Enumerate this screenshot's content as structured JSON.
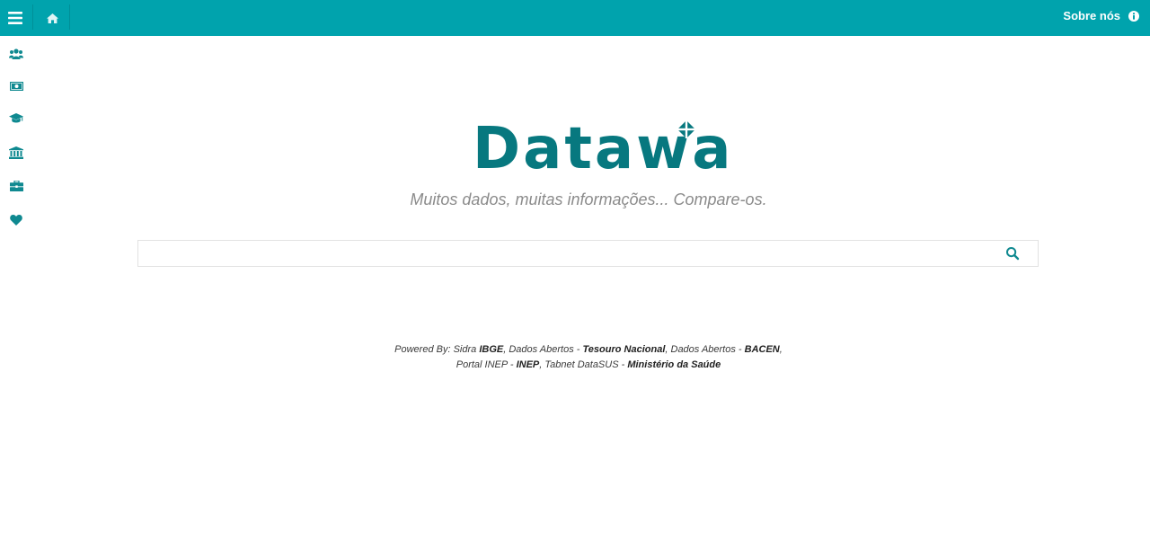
{
  "colors": {
    "brand": "#00a3ad",
    "logo": "#07787f",
    "icon": "#0f8990",
    "tagline": "#8b8b8b"
  },
  "topbar": {
    "menu_icon": "hamburger-menu-icon",
    "home_icon": "home-icon",
    "about_label": "Sobre nós",
    "about_icon": "info-circle-icon"
  },
  "sidebar": {
    "items": [
      {
        "icon": "users-icon"
      },
      {
        "icon": "money-bill-icon"
      },
      {
        "icon": "graduation-cap-icon"
      },
      {
        "icon": "institution-icon"
      },
      {
        "icon": "briefcase-icon"
      },
      {
        "icon": "heart-icon"
      }
    ]
  },
  "logo": {
    "text": "Datawa"
  },
  "tagline": "Muitos dados, muitas informações... Compare-os.",
  "search": {
    "value": "",
    "placeholder": "",
    "icon": "search-icon"
  },
  "credits": {
    "intro": "Powered By: Sidra ",
    "sources": [
      {
        "name": "IBGE",
        "sep": ", "
      },
      {
        "name": "Dados Abertos - ",
        "bold": "Tesouro Nacional",
        "sep": ", "
      },
      {
        "name": "Dados Abertos - ",
        "bold": "BACEN",
        "sep": ","
      }
    ],
    "line2": [
      {
        "name": "Portal INEP - ",
        "bold": "INEP",
        "sep": ", "
      },
      {
        "name": "Tabnet DataSUS - ",
        "bold": "Ministério da Saúde",
        "sep": ""
      }
    ]
  }
}
